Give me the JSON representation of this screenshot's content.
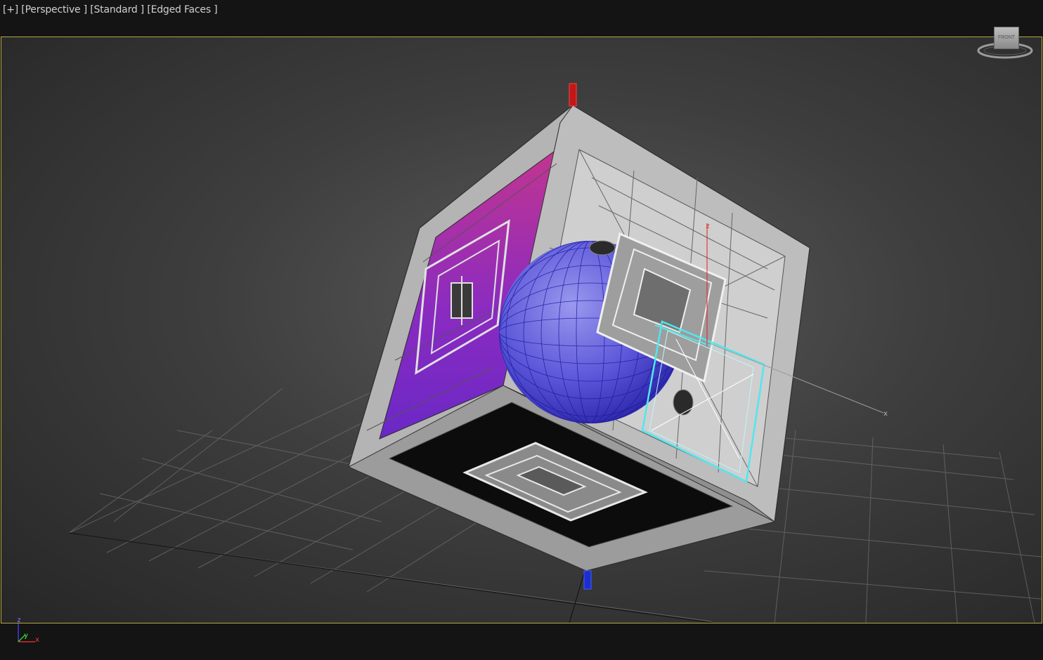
{
  "viewport": {
    "label": "[+] [Perspective ] [Standard ] [Edged Faces ]",
    "view": "Perspective",
    "shading": "Standard",
    "display_mode": "Edged Faces",
    "border_color": "#b6a743"
  },
  "viewcube": {
    "face_label": "FRONT"
  },
  "axis_tripod": {
    "z": "z",
    "y": "y",
    "x": "x"
  },
  "gizmo_labels": {
    "z": "z",
    "x": "x"
  },
  "colors": {
    "background_top": "#141414",
    "viewport_bg": "#3e3e3e",
    "grid": "#6a6a6a",
    "cube_faces": "#a8a8a8",
    "magenta_face": "#b233c8",
    "sphere": "#3a32c8",
    "selection": "#4fe8f0",
    "z_axis": "#ff2020",
    "y_axis": "#2040ff",
    "x_axis": "#ff3030"
  },
  "icons": [
    "viewcube-icon",
    "axis-tripod-icon",
    "transform-gizmo-icon"
  ]
}
